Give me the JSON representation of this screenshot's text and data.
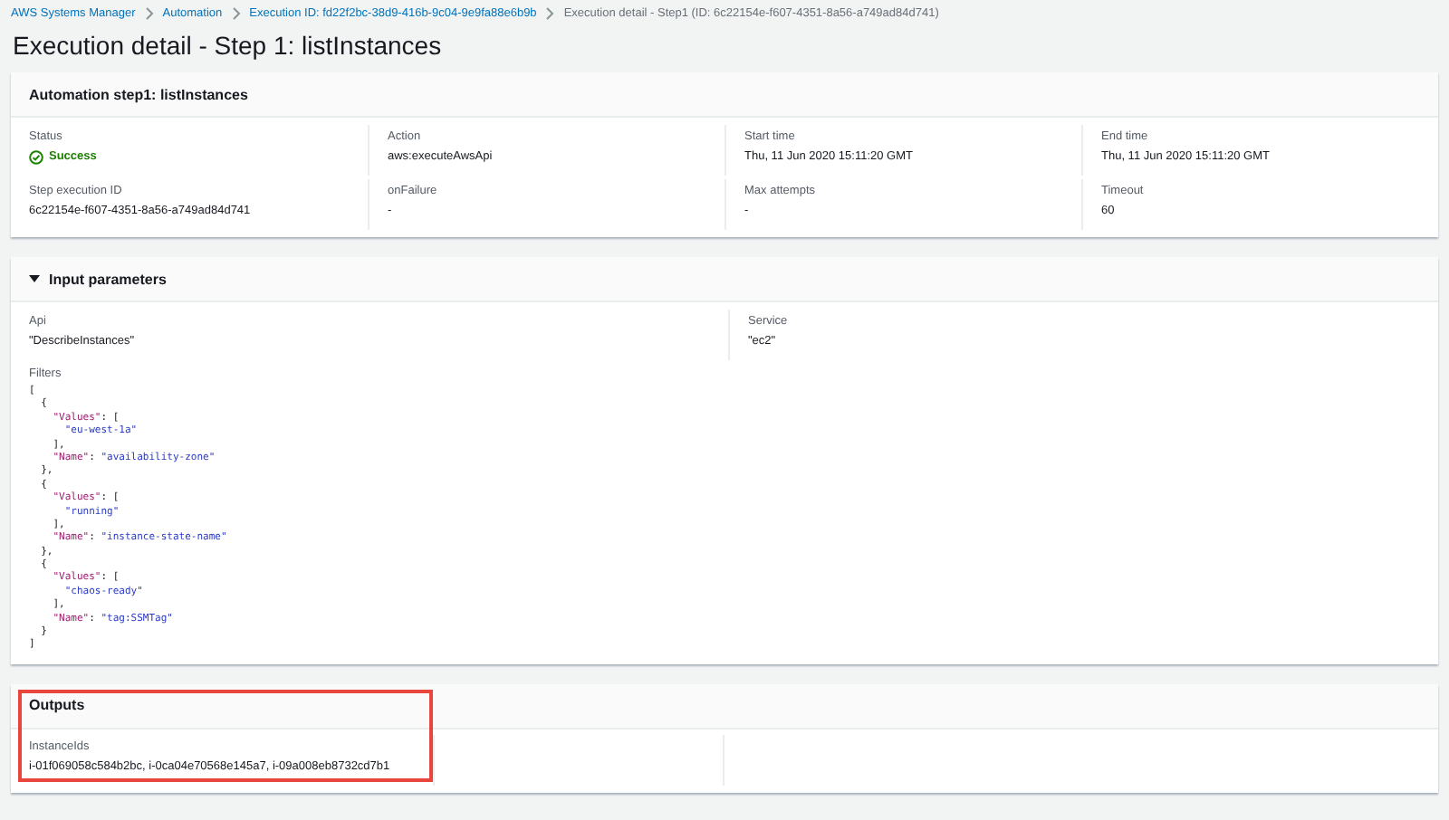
{
  "breadcrumbs": [
    {
      "label": "AWS Systems Manager",
      "link": true
    },
    {
      "label": "Automation",
      "link": true
    },
    {
      "label": "Execution ID: fd22f2bc-38d9-416b-9c04-9e9fa88e6b9b",
      "link": true
    },
    {
      "label": "Execution detail - Step1 (ID: 6c22154e-f607-4351-8a56-a749ad84d741)",
      "link": false
    }
  ],
  "title": "Execution detail - Step 1: listInstances",
  "step_panel": {
    "title": "Automation step1: listInstances",
    "fields": [
      {
        "label": "Status",
        "value": "Success",
        "kind": "status"
      },
      {
        "label": "Action",
        "value": "aws:executeAwsApi",
        "kind": "text"
      },
      {
        "label": "Start time",
        "value": "Thu, 11 Jun 2020 15:11:20 GMT",
        "kind": "text"
      },
      {
        "label": "End time",
        "value": "Thu, 11 Jun 2020 15:11:20 GMT",
        "kind": "text"
      },
      {
        "label": "Step execution ID",
        "value": "6c22154e-f607-4351-8a56-a749ad84d741",
        "kind": "text"
      },
      {
        "label": "onFailure",
        "value": "-",
        "kind": "text"
      },
      {
        "label": "Max attempts",
        "value": "-",
        "kind": "text"
      },
      {
        "label": "Timeout",
        "value": "60",
        "kind": "text"
      }
    ]
  },
  "input_panel": {
    "title": "Input parameters",
    "expanded": true,
    "api": {
      "label": "Api",
      "value": "\"DescribeInstances\""
    },
    "service": {
      "label": "Service",
      "value": "\"ec2\""
    },
    "filters_label": "Filters",
    "code": [
      [
        {
          "kind": "punct",
          "text": "["
        }
      ],
      [
        {
          "kind": "punct",
          "text": "  {"
        }
      ],
      [
        {
          "kind": "key",
          "text": "    \"Values\""
        },
        {
          "kind": "punct",
          "text": ": ["
        }
      ],
      [
        {
          "kind": "string",
          "text": "      \"eu-west-1a\""
        }
      ],
      [
        {
          "kind": "punct",
          "text": "    ],"
        }
      ],
      [
        {
          "kind": "key",
          "text": "    \"Name\""
        },
        {
          "kind": "punct",
          "text": ": "
        },
        {
          "kind": "string",
          "text": "\"availability-zone\""
        }
      ],
      [
        {
          "kind": "punct",
          "text": "  },"
        }
      ],
      [
        {
          "kind": "punct",
          "text": "  {"
        }
      ],
      [
        {
          "kind": "key",
          "text": "    \"Values\""
        },
        {
          "kind": "punct",
          "text": ": ["
        }
      ],
      [
        {
          "kind": "string",
          "text": "      \"running\""
        }
      ],
      [
        {
          "kind": "punct",
          "text": "    ],"
        }
      ],
      [
        {
          "kind": "key",
          "text": "    \"Name\""
        },
        {
          "kind": "punct",
          "text": ": "
        },
        {
          "kind": "string",
          "text": "\"instance-state-name\""
        }
      ],
      [
        {
          "kind": "punct",
          "text": "  },"
        }
      ],
      [
        {
          "kind": "punct",
          "text": "  {"
        }
      ],
      [
        {
          "kind": "key",
          "text": "    \"Values\""
        },
        {
          "kind": "punct",
          "text": ": ["
        }
      ],
      [
        {
          "kind": "string",
          "text": "      \"chaos-ready\""
        }
      ],
      [
        {
          "kind": "punct",
          "text": "    ],"
        }
      ],
      [
        {
          "kind": "key",
          "text": "    \"Name\""
        },
        {
          "kind": "punct",
          "text": ": "
        },
        {
          "kind": "string",
          "text": "\"tag:SSMTag\""
        }
      ],
      [
        {
          "kind": "punct",
          "text": "  }"
        }
      ],
      [
        {
          "kind": "punct",
          "text": "]"
        }
      ]
    ]
  },
  "outputs_panel": {
    "title": "Outputs",
    "label": "InstanceIds",
    "value": "i-01f069058c584b2bc, i-0ca04e70568e145a7, i-09a008eb8732cd7b1"
  }
}
